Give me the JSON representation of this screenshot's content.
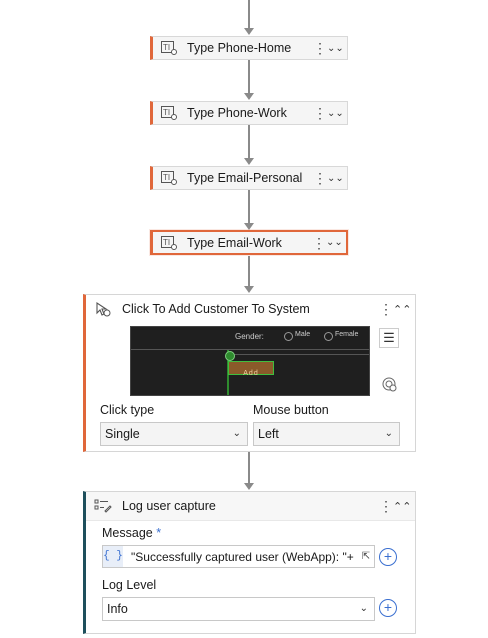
{
  "activities": [
    {
      "label": "Type Phone-Home"
    },
    {
      "label": "Type Phone-Work"
    },
    {
      "label": "Type Email-Personal"
    },
    {
      "label": "Type Email-Work"
    }
  ],
  "click_card": {
    "title": "Click To Add Customer To System",
    "preview": {
      "gender_label": "Gender:",
      "male_label": "Male",
      "female_label": "Female",
      "add_label": "Add"
    },
    "click_type_label": "Click type",
    "click_type_value": "Single",
    "mouse_button_label": "Mouse button",
    "mouse_button_value": "Left"
  },
  "log_card": {
    "title": "Log user capture",
    "message_label": "Message",
    "required_mark": "*",
    "message_prefix": "{ }",
    "message_value": "\"Successfully captured user (WebApp): \"+",
    "log_level_label": "Log Level",
    "log_level_value": "Info"
  },
  "colors": {
    "accent_orange": "#e0673a",
    "accent_teal": "#1e4f5c",
    "link_blue": "#3a6fd0"
  }
}
